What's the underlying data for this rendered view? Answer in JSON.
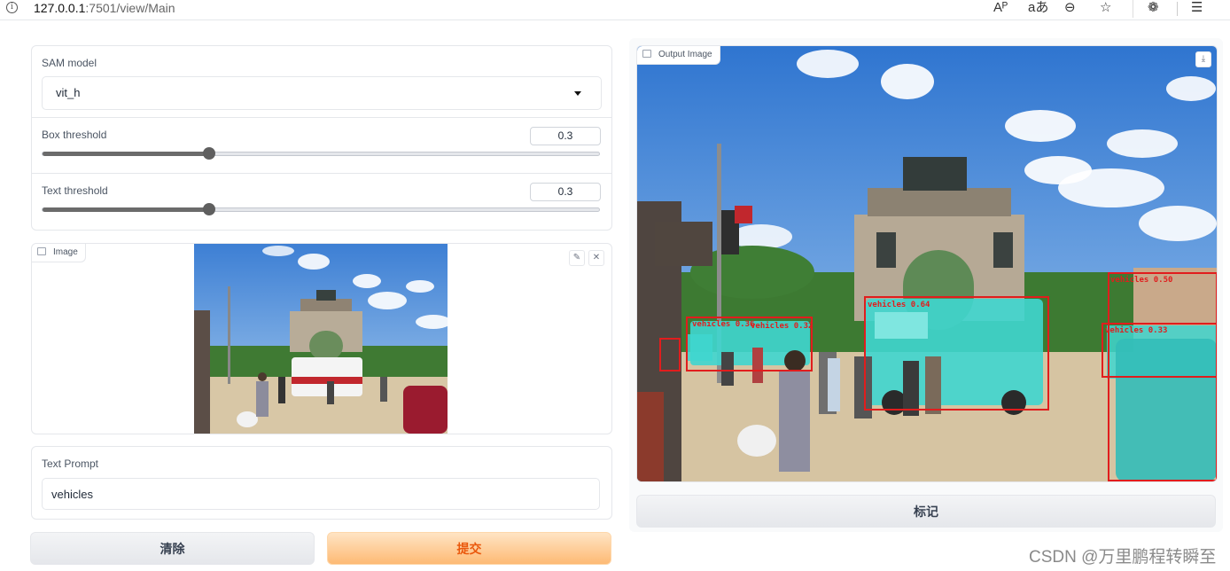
{
  "browser": {
    "url_host": "127.0.0.1",
    "url_path": ":7501/view/Main",
    "info_glyph": "i",
    "read_aloud_glyph": "Aᴾ",
    "translate_glyph": "aあ",
    "zoom_glyph": "⊖",
    "favorite_glyph": "☆",
    "extensions_glyph": "❁",
    "favorites_bar_glyph": "☰"
  },
  "controls": {
    "sam_model": {
      "label": "SAM model",
      "value": "vit_h"
    },
    "box_threshold": {
      "label": "Box threshold",
      "value": "0.3",
      "level": 0.3
    },
    "text_threshold": {
      "label": "Text threshold",
      "value": "0.3",
      "level": 0.3
    }
  },
  "input_image": {
    "label": "Image",
    "edit_glyph": "✎",
    "close_glyph": "✕"
  },
  "text_prompt": {
    "label": "Text Prompt",
    "value": "vehicles"
  },
  "buttons": {
    "clear": "清除",
    "submit": "提交",
    "mark": "标记"
  },
  "output_image": {
    "label": "Output Image",
    "download_glyph": "⤓",
    "detections": [
      {
        "label": "vehicles 0.64"
      },
      {
        "label": "vehicles 0.50"
      },
      {
        "label": "vehicles 0.33"
      },
      {
        "label": "vehicles 0.36"
      },
      {
        "label": "vehicles 0.32"
      }
    ]
  },
  "watermark": "CSDN @万里鹏程转瞬至",
  "colors": {
    "primary_button": "#fdba74",
    "primary_text": "#ea580c",
    "detection_box": "#e11d1d",
    "mask": "#3fd6cf"
  }
}
